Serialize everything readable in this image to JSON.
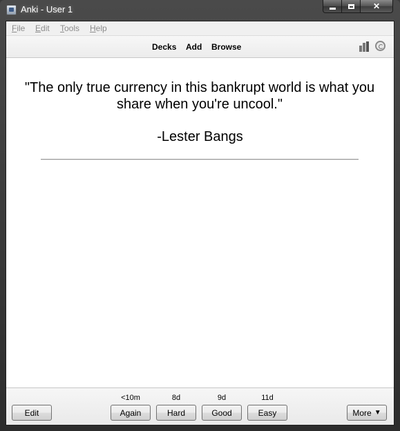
{
  "window": {
    "title": "Anki - User 1"
  },
  "menu": [
    {
      "label": "File",
      "mnemonic": "F",
      "rest": "ile"
    },
    {
      "label": "Edit",
      "mnemonic": "E",
      "rest": "dit"
    },
    {
      "label": "Tools",
      "mnemonic": "T",
      "rest": "ools"
    },
    {
      "label": "Help",
      "mnemonic": "H",
      "rest": "elp"
    }
  ],
  "toolbar": {
    "decks": "Decks",
    "add": "Add",
    "browse": "Browse",
    "stats_icon": "stats-bars-icon",
    "sync_icon": "sync-icon"
  },
  "card": {
    "quote": "\"The only true currency in this bankrupt world is what you share when you're uncool.\"",
    "author": "-Lester Bangs"
  },
  "bottom": {
    "edit_label": "Edit",
    "more_label": "More",
    "more_arrow": "▼",
    "answers": [
      {
        "interval": "<10m",
        "label": "Again"
      },
      {
        "interval": "8d",
        "label": "Hard"
      },
      {
        "interval": "9d",
        "label": "Good"
      },
      {
        "interval": "11d",
        "label": "Easy"
      }
    ]
  }
}
